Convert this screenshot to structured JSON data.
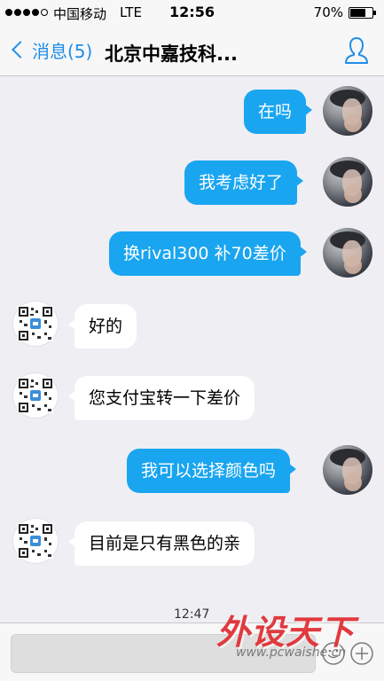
{
  "status_bar": {
    "carrier": "中国移动",
    "network": "LTE",
    "time": "12:56",
    "battery_percent": "70%",
    "battery_level": 0.7
  },
  "nav": {
    "back_label": "消息(5)",
    "title": "北京中嘉技科...",
    "profile_icon": "person-icon"
  },
  "messages": [
    {
      "from": "me",
      "text": "在吗"
    },
    {
      "from": "me",
      "text": "我考虑好了"
    },
    {
      "from": "me",
      "text": "换rival300 补70差价"
    },
    {
      "from": "them",
      "text": "好的"
    },
    {
      "from": "them",
      "text": "您支付宝转一下差价"
    },
    {
      "from": "me",
      "text": "我可以选择颜色吗"
    },
    {
      "from": "them",
      "text": "目前是只有黑色的亲"
    }
  ],
  "last_timestamp": "12:47",
  "input": {
    "value": "",
    "emoji_icon": "smiley-icon",
    "plus_icon": "plus-icon"
  },
  "watermark": {
    "title": "外设天下",
    "url": "www.pcwaishe.cn"
  },
  "colors": {
    "accent": "#1e8ee8",
    "outgoing_bubble": "#1aa5f0",
    "incoming_bubble": "#ffffff",
    "background": "#eeeef3",
    "watermark": "#e03a3e"
  }
}
